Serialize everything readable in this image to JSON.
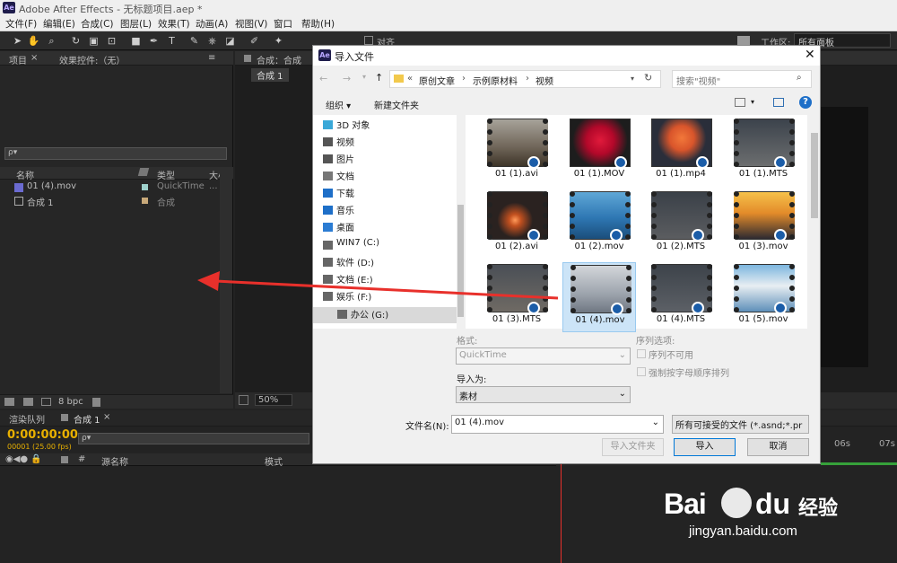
{
  "window": {
    "title": "Adobe After Effects - 无标题项目.aep *",
    "logo": "Ae"
  },
  "menu": [
    "文件(F)",
    "编辑(E)",
    "合成(C)",
    "图层(L)",
    "效果(T)",
    "动画(A)",
    "视图(V)",
    "窗口",
    "帮助(H)"
  ],
  "toolbar": {
    "align_label": "对齐",
    "workspace_label": "工作区:",
    "workspace_value": "所有面板"
  },
  "project": {
    "tab1": "项目",
    "tab2": "效果控件:（无）",
    "search_placeholder": "ρ▾",
    "cols": {
      "name": "名称",
      "type": "类型",
      "size": "大小"
    },
    "items": [
      {
        "name": "01 (4).mov",
        "type": "QuickTime",
        "size": "..."
      },
      {
        "name": "合成 1",
        "type": "合成",
        "size": ""
      }
    ],
    "bpc": "8 bpc"
  },
  "comp": {
    "tab": "合成：合成",
    "sub_tab": "合成 1",
    "zoom": "50%"
  },
  "dialog": {
    "title": "导入文件",
    "path": [
      "原创文章",
      "示例原材料",
      "视频"
    ],
    "search_placeholder": "搜索\"视频\"",
    "organize": "组织 ▾",
    "new_folder": "新建文件夹",
    "nav": [
      {
        "label": "3D 对象",
        "icon": "3d-object-icon",
        "color": "#3aa8d8"
      },
      {
        "label": "视频",
        "icon": "video-icon",
        "color": "#555"
      },
      {
        "label": "图片",
        "icon": "picture-icon",
        "color": "#555"
      },
      {
        "label": "文档",
        "icon": "document-icon",
        "color": "#777"
      },
      {
        "label": "下载",
        "icon": "download-icon",
        "color": "#1e6fc8"
      },
      {
        "label": "音乐",
        "icon": "music-icon",
        "color": "#1e6fc8"
      },
      {
        "label": "桌面",
        "icon": "desktop-icon",
        "color": "#2b7cd3"
      },
      {
        "label": "WIN7 (C:)",
        "icon": "drive-icon",
        "color": "#666"
      },
      {
        "label": "软件 (D:)",
        "icon": "drive-icon",
        "color": "#666"
      },
      {
        "label": "文档 (E:)",
        "icon": "drive-icon",
        "color": "#666"
      },
      {
        "label": "娱乐 (F:)",
        "icon": "drive-icon",
        "color": "#666"
      },
      {
        "label": "办公 (G:)",
        "icon": "drive-icon",
        "color": "#666"
      }
    ],
    "files": [
      {
        "name": "01 (1).avi",
        "film": true,
        "bg": "linear-gradient(#a7a39a,#6f6558 60%,#3d3428)"
      },
      {
        "name": "01 (1).MOV",
        "film": false,
        "bg": "radial-gradient(circle at 50% 45%,#e01a3b 0,#b3082a 35%,#1d1d1d 70%)"
      },
      {
        "name": "01 (1).mp4",
        "film": false,
        "bg": "radial-gradient(circle at 50% 40%,#f2783a 0,#d9552b 30%,#2a2e3a 60%)"
      },
      {
        "name": "01 (1).MTS",
        "film": true,
        "bg": "linear-gradient(#3c434c,#6c6e6f)"
      },
      {
        "name": "01 (2).avi",
        "film": true,
        "bg": "radial-gradient(circle at 45% 60%,#ff9a5a 0,#c2501f 15%,#2a2220 45%)"
      },
      {
        "name": "01 (2).mov",
        "film": true,
        "bg": "linear-gradient(#5fa7d6,#2e77b3 55%,#1b4e7b)"
      },
      {
        "name": "01 (2).MTS",
        "film": true,
        "bg": "linear-gradient(#3a4048,#5b5d60)"
      },
      {
        "name": "01 (3).mov",
        "film": true,
        "bg": "linear-gradient(#f6c14a,#e38b2a 45%,#2d2a30)"
      },
      {
        "name": "01 (3).MTS",
        "film": true,
        "bg": "linear-gradient(#4a4f56,#6f6a64)"
      },
      {
        "name": "01 (4).mov",
        "film": true,
        "bg": "linear-gradient(#d3d6da,#9da4ad 60%,#6f7782)",
        "selected": true
      },
      {
        "name": "01 (4).MTS",
        "film": true,
        "bg": "linear-gradient(#3d434a,#5c6066)"
      },
      {
        "name": "01 (5).mov",
        "film": true,
        "bg": "linear-gradient(#7cb6df,#e8eef2 45%,#5e8fb9)"
      }
    ],
    "format_label": "格式:",
    "format_value": "QuickTime",
    "import_as_label": "导入为:",
    "import_as_value": "素材",
    "seq_label": "序列选项:",
    "seq1": "序列不可用",
    "seq2": "强制按字母顺序排列",
    "filename_label": "文件名(N):",
    "filename": "01 (4).mov",
    "filter": "所有可接受的文件 (*.asnd;*.pr",
    "import_folder": "导入文件夹",
    "import": "导入",
    "cancel": "取消"
  },
  "timeline": {
    "tab_render": "渲染队列",
    "tab_comp": "合成 1",
    "timecode": "0:00:00:00",
    "frames": "00001 (25.00 fps)",
    "search": "ρ▾",
    "col_name": "源名称",
    "col_mode": "模式",
    "ruler": [
      "06s",
      "07s"
    ]
  },
  "watermark": {
    "brand": "Bai",
    "brand2": "du",
    "cn": "经验",
    "url": "jingyan.baidu.com"
  },
  "colors": {
    "accent_arrow": "#e8302b",
    "timecode": "#e8b000",
    "select": "#cce4f7"
  }
}
